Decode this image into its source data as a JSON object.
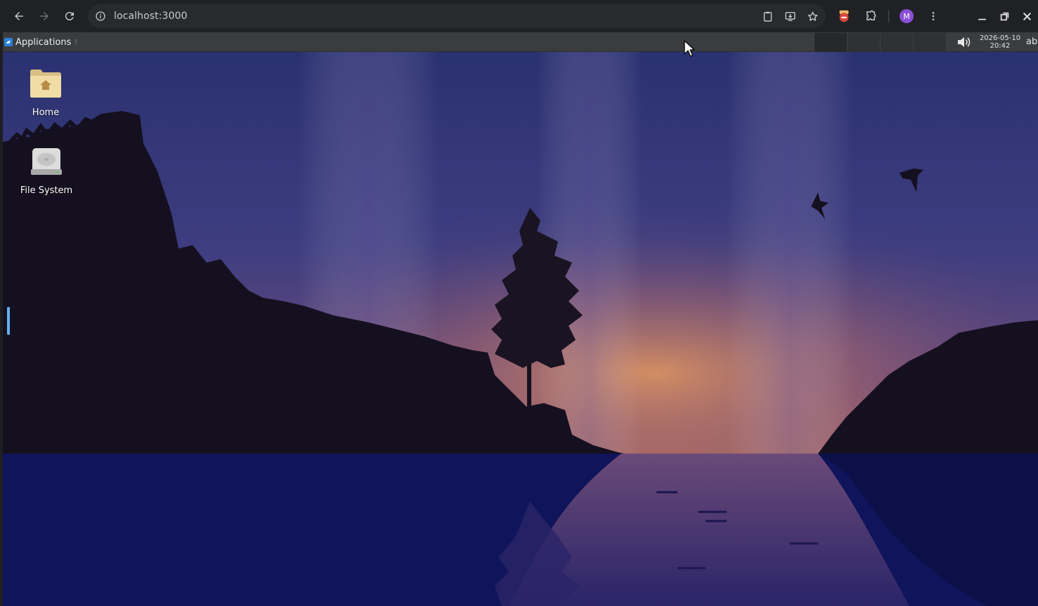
{
  "browser": {
    "url": "localhost:3000",
    "profile_initial": "M",
    "icons": {
      "back": "arrow-left-icon",
      "forward": "arrow-right-icon",
      "reload": "reload-icon",
      "site_info": "info-icon",
      "clipboard": "clipboard-icon",
      "install": "install-app-icon",
      "bookmark": "star-icon",
      "extension_app": "extension-app-icon",
      "extensions": "puzzle-icon",
      "menu": "kebab-menu-icon"
    }
  },
  "panel": {
    "applications_label": "Applications",
    "clock_date": "2026-05-10",
    "clock_time": "20:42",
    "tail_text": "ab",
    "workspaces": 4
  },
  "desktop": {
    "icons": [
      {
        "label": "Home"
      },
      {
        "label": "File System"
      }
    ]
  },
  "colors": {
    "browser_bg": "#202124",
    "omnibox_bg": "#282a2d",
    "panel_bg": "#3a3c3e",
    "sky_top": "#2e3a78",
    "horizon_glow": "#c47a52",
    "water": "#12185a"
  }
}
